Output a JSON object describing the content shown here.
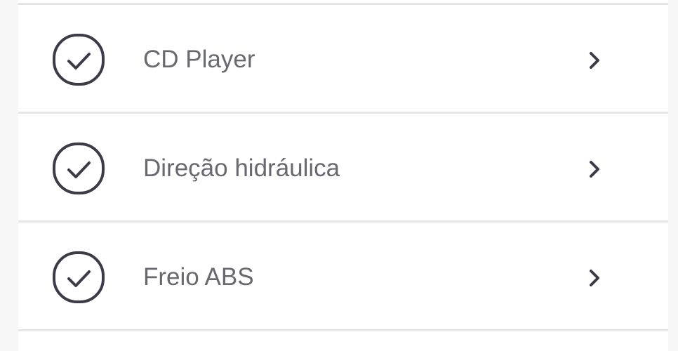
{
  "list": {
    "items": [
      {
        "label": "CD Player",
        "checked": true
      },
      {
        "label": "Direção hidráulica",
        "checked": true
      },
      {
        "label": "Freio ABS",
        "checked": true
      }
    ]
  },
  "colors": {
    "background": "#f7f7f8",
    "card": "#ffffff",
    "divider": "#e6e6e8",
    "text": "#686870",
    "icon": "#3c3b47"
  },
  "icons": {
    "check": "check-circle-icon",
    "chevron": "chevron-right-icon"
  }
}
